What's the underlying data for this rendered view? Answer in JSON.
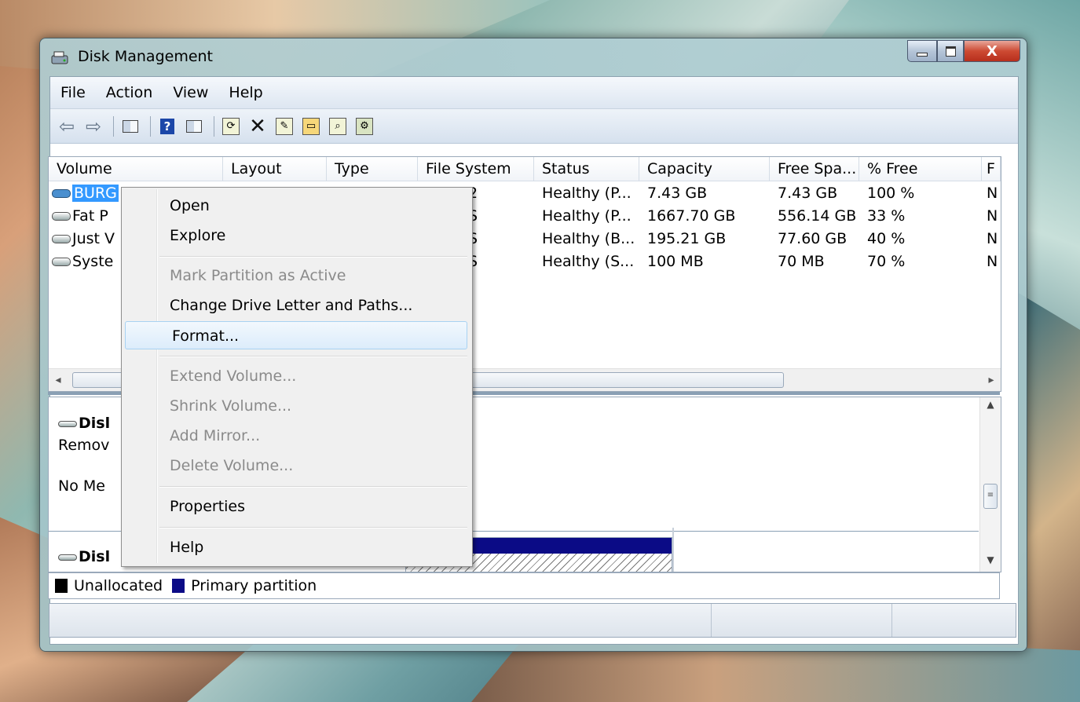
{
  "window": {
    "title": "Disk Management",
    "close_glyph": "X"
  },
  "menubar": [
    "File",
    "Action",
    "View",
    "Help"
  ],
  "toolbar_icons": [
    "back-arrow-icon",
    "forward-arrow-icon",
    "console-tree-icon",
    "help-icon",
    "action-pane-icon",
    "refresh-icon",
    "delete-icon",
    "properties-icon",
    "open-icon",
    "explore-icon",
    "settings-icon"
  ],
  "columns": [
    "Volume",
    "Layout",
    "Type",
    "File System",
    "Status",
    "Capacity",
    "Free Spa...",
    "% Free",
    "F"
  ],
  "volumes": [
    {
      "volume": "BURG",
      "fs": "2",
      "status": "Healthy (P...",
      "capacity": "7.43 GB",
      "free": "7.43 GB",
      "pct": "100 %",
      "f": "N"
    },
    {
      "volume": "Fat P",
      "fs": "S",
      "status": "Healthy (P...",
      "capacity": "1667.70 GB",
      "free": "556.14 GB",
      "pct": "33 %",
      "f": "N"
    },
    {
      "volume": "Just V",
      "fs": "S",
      "status": "Healthy (B...",
      "capacity": "195.21 GB",
      "free": "77.60 GB",
      "pct": "40 %",
      "f": "N"
    },
    {
      "volume": "Syste",
      "fs": "S",
      "status": "Healthy (S...",
      "capacity": "100 MB",
      "free": "70 MB",
      "pct": "70 %",
      "f": "N"
    }
  ],
  "graph": {
    "disk1": {
      "name": "Disl",
      "type": "Remov",
      "media": "No Me"
    },
    "disk2": {
      "name": "Disl"
    }
  },
  "legend": [
    {
      "label": "Unallocated",
      "color": "#000000"
    },
    {
      "label": "Primary partition",
      "color": "#0b0b86"
    }
  ],
  "context_menu": {
    "items": [
      {
        "label": "Open",
        "disabled": false
      },
      {
        "label": "Explore",
        "disabled": false
      },
      {
        "label": "Mark Partition as Active",
        "disabled": true
      },
      {
        "label": "Change Drive Letter and Paths...",
        "disabled": false
      },
      {
        "label": "Format...",
        "disabled": false,
        "hover": true
      },
      {
        "label": "Extend Volume...",
        "disabled": true
      },
      {
        "label": "Shrink Volume...",
        "disabled": true
      },
      {
        "label": "Add Mirror...",
        "disabled": true
      },
      {
        "label": "Delete Volume...",
        "disabled": true
      },
      {
        "label": "Properties",
        "disabled": false
      },
      {
        "label": "Help",
        "disabled": false
      }
    ]
  },
  "colors": {
    "selection": "#3399ff",
    "primary_partition": "#0b0b86",
    "close_button": "#cd4a33"
  }
}
